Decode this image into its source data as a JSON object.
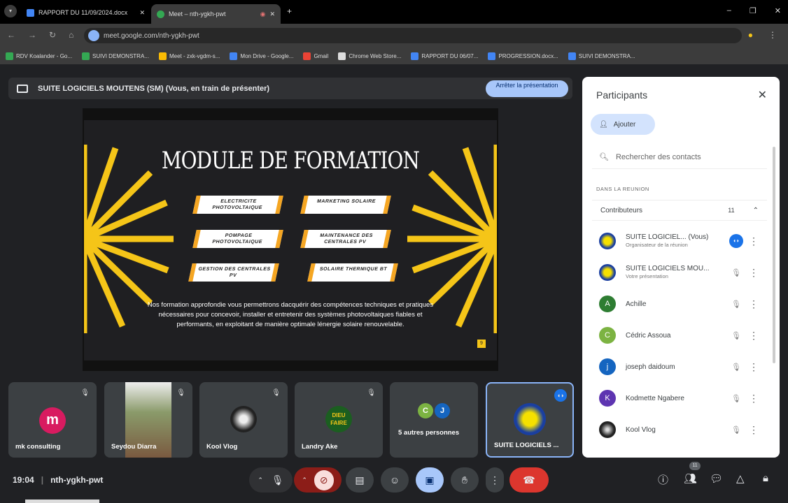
{
  "browser": {
    "tabs": [
      {
        "label": "RAPPORT DU 11/09/2024.docx"
      },
      {
        "label": "Meet – nth-ygkh-pwt"
      }
    ],
    "new_tab": "+",
    "url": "meet.google.com/nth-ygkh-pwt",
    "bookmarks": [
      "RDV Koalander - Go...",
      "SUIVI DEMONSTRA...",
      "Meet - zxk-vgdm-s...",
      "Mon Drive - Google...",
      "Gmail",
      "Chrome Web Store...",
      "RAPPORT DU 06/07...",
      "PROGRESSION.docx...",
      "SUIVI DEMONSTRA..."
    ],
    "window_controls": [
      "–",
      "❐",
      "✕"
    ]
  },
  "banner": {
    "text": "SUITE LOGICIELS MOUTENS (SM) (Vous, en train de présenter)",
    "stop_label": "Arrêter la présentation"
  },
  "slide": {
    "title": "MODULE DE FORMATION",
    "modules": [
      "ELECTRICITE PHOTOVOLTAIQUE",
      "MARKETING SOLAIRE",
      "POMPAGE PHOTOVOLTAIQUE",
      "MAINTENANCE DES CENTRALES PV",
      "GESTION DES CENTRALES PV",
      "SOLAIRE THERMIQUE BT"
    ],
    "description": "Nos formation approfondie vous permettrons dacquérir des compétences techniques et pratiques nécessaires pour concevoir, installer et entretenir des systèmes photovoltaiques fiables et performants, en exploitant de manière optimale lénergie solaire renouvelable.",
    "page": "9",
    "accent": "#f5c518"
  },
  "tiles": [
    {
      "name": "mk consulting",
      "initial": "m",
      "color": "#d81b60"
    },
    {
      "name": "Seydou Diarra"
    },
    {
      "name": "Kool Vlog"
    },
    {
      "name": "Landry Ake",
      "logo": "DIEU FAIRE"
    },
    {
      "name": "5 autres personnes",
      "initials": [
        "C",
        "J"
      ]
    },
    {
      "name": "SUITE LOGICIELS ..."
    }
  ],
  "panel": {
    "title": "Participants",
    "add_label": "Ajouter",
    "search_placeholder": "Rechercher des contacts",
    "section": "DANS LA REUNION",
    "group": "Contributeurs",
    "count": "11",
    "participants": [
      {
        "name": "SUITE LOGICIEL...  (Vous)",
        "sub": "Organisateur de la réunion"
      },
      {
        "name": "SUITE LOGICIELS MOU...",
        "sub": "Votre présentation"
      },
      {
        "name": "Achille",
        "initial": "A",
        "color": "#2e7d32"
      },
      {
        "name": "Cédric Assoua",
        "initial": "C",
        "color": "#7cb342"
      },
      {
        "name": "joseph daidoum",
        "initial": "j",
        "color": "#1565c0"
      },
      {
        "name": "Kodmette Ngabere",
        "initial": "K",
        "color": "#5e35b1"
      },
      {
        "name": "Kool Vlog"
      }
    ]
  },
  "bottom": {
    "time": "19:04",
    "meeting_code": "nth-ygkh-pwt",
    "participant_badge": "11"
  }
}
